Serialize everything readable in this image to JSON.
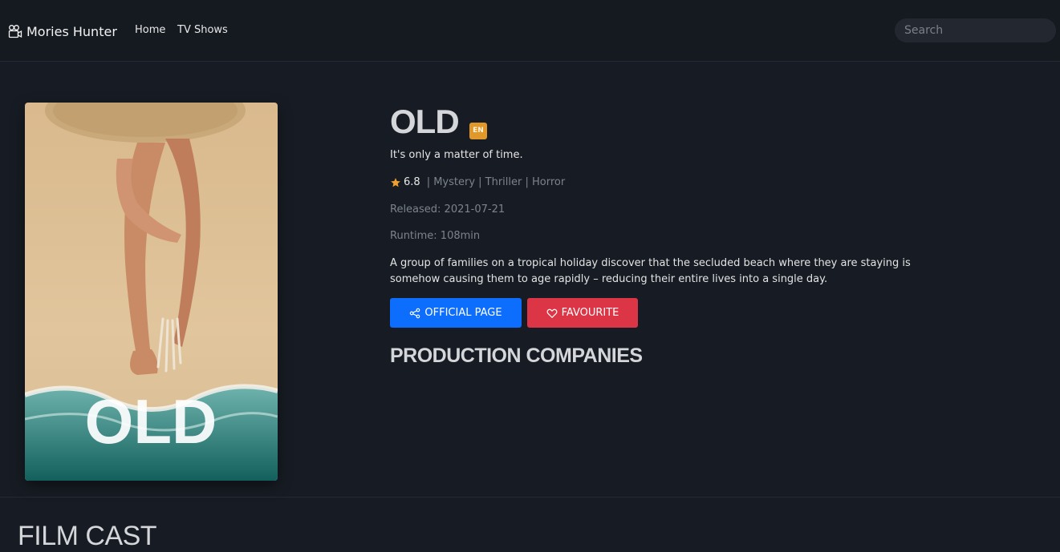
{
  "navbar": {
    "brand": "Mories Hunter",
    "links": [
      "Home",
      "TV Shows"
    ],
    "search_placeholder": "Search"
  },
  "movie": {
    "poster_title": "OLD",
    "title": "OLD",
    "language": "EN",
    "tagline": "It's only a matter of time.",
    "rating": "6.8",
    "genres": "| Mystery | Thriller | Horror",
    "released": "Released: 2021-07-21",
    "runtime": "Runtime: 108min",
    "overview": "A group of families on a tropical holiday discover that the secluded beach where they are staying is somehow causing them to age rapidly – reducing their entire lives into a single day."
  },
  "buttons": {
    "official": "OFFICIAL PAGE",
    "favourite": "FAVOURITE"
  },
  "sections": {
    "production": "PRODUCTION COMPANIES",
    "cast": "FILM CAST"
  },
  "colors": {
    "background": "#171c24",
    "primary": "#0d6efd",
    "danger": "#dc3545",
    "badge": "#e0982b",
    "star": "#f0a030"
  }
}
